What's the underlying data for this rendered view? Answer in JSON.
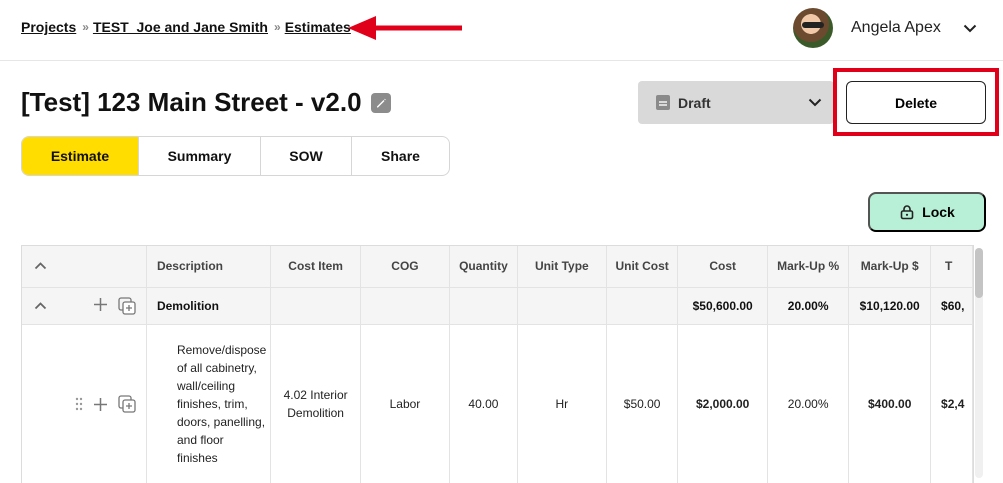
{
  "breadcrumb": {
    "items": [
      "Projects",
      "TEST_Joe and Jane Smith",
      "Estimates"
    ],
    "separator": "»"
  },
  "user": {
    "name": "Angela Apex"
  },
  "page": {
    "title": "[Test] 123 Main Street - v2.0"
  },
  "status_select": {
    "selected": "Draft"
  },
  "actions": {
    "delete_label": "Delete",
    "lock_label": "Lock"
  },
  "tabs": [
    {
      "label": "Estimate",
      "active": true
    },
    {
      "label": "Summary",
      "active": false
    },
    {
      "label": "SOW",
      "active": false
    },
    {
      "label": "Share",
      "active": false
    }
  ],
  "table": {
    "columns": [
      "Description",
      "Cost Item",
      "COG",
      "Quantity",
      "Unit Type",
      "Unit Cost",
      "Cost",
      "Mark-Up %",
      "Mark-Up $",
      "T"
    ],
    "group": {
      "description": "Demolition",
      "cost_item": "",
      "cog": "",
      "quantity": "",
      "unit_type": "",
      "unit_cost": "",
      "cost": "$50,600.00",
      "markup_pct": "20.00%",
      "markup_amt": "$10,120.00",
      "total": "$60,"
    },
    "item": {
      "description": "Remove/dispose of all cabinetry, wall/ceiling finishes, trim, doors, panelling, and floor finishes",
      "cost_item": "4.02 Interior Demolition",
      "cog": "Labor",
      "quantity": "40.00",
      "unit_type": "Hr",
      "unit_cost": "$50.00",
      "cost": "$2,000.00",
      "markup_pct": "20.00%",
      "markup_amt": "$400.00",
      "total": "$2,4"
    }
  },
  "colors": {
    "active_tab": "#ffdd00",
    "lock_button": "#b7f0d6",
    "highlight_red": "#e0001a",
    "status_select_bg": "#d9d9d9"
  }
}
